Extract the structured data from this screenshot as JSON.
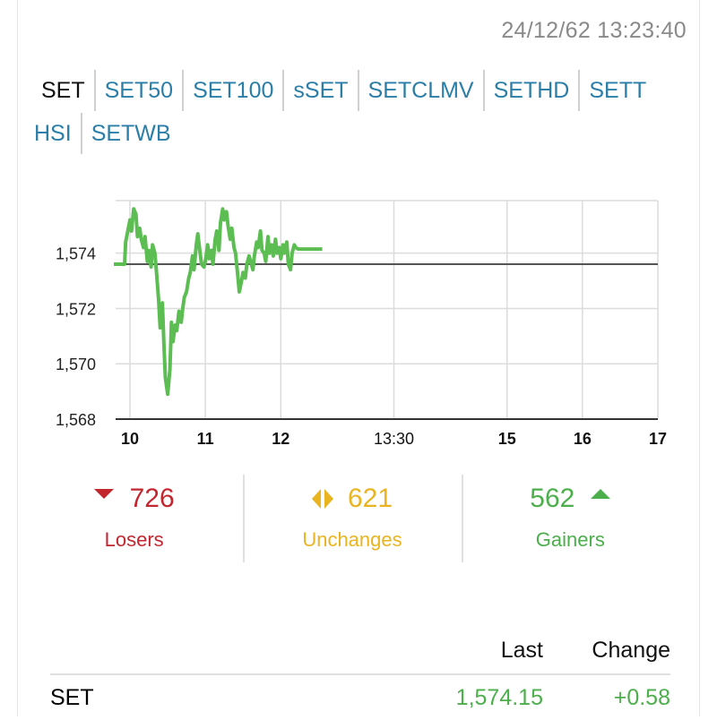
{
  "timestamp": "24/12/62 13:23:40",
  "tabs": {
    "row1": [
      "SET",
      "SET50",
      "SET100",
      "sSET",
      "SETCLMV",
      "SETHD",
      "SETT"
    ],
    "row2": [
      "HSI",
      "SETWB"
    ],
    "active": "SET"
  },
  "chart_data": {
    "type": "line",
    "x_ticks": [
      "10",
      "11",
      "12",
      "13:30",
      "15",
      "16",
      "17"
    ],
    "y_ticks": [
      "1,574",
      "1,572",
      "1,570",
      "1,568"
    ],
    "ylim": [
      1568,
      1575.9
    ],
    "reference_line": 1573.6,
    "series": [
      {
        "color": "#5cbd52",
        "x": [
          9.85,
          9.95,
          9.96,
          9.98,
          10.0,
          10.02,
          10.05,
          10.08,
          10.1,
          10.13,
          10.15,
          10.18,
          10.2,
          10.23,
          10.25,
          10.28,
          10.3,
          10.33,
          10.35,
          10.38,
          10.4,
          10.43,
          10.45,
          10.47,
          10.5,
          10.53,
          10.55,
          10.57,
          10.6,
          10.62,
          10.65,
          10.68,
          10.7,
          10.72,
          10.75,
          10.78,
          10.8,
          10.83,
          10.85,
          10.88,
          10.9,
          10.93,
          10.95,
          10.98,
          11.0,
          11.03,
          11.05,
          11.08,
          11.1,
          11.13,
          11.15,
          11.18,
          11.2,
          11.23,
          11.25,
          11.28,
          11.3,
          11.33,
          11.35,
          11.38,
          11.4,
          11.43,
          11.45,
          11.48,
          11.5,
          11.53,
          11.55,
          11.58,
          11.6,
          11.63,
          11.65,
          11.68,
          11.7,
          11.73,
          11.75,
          11.78,
          11.8,
          11.83,
          11.85,
          11.88,
          11.9,
          11.93,
          11.95,
          11.98,
          12.0,
          12.03,
          12.05,
          12.08,
          12.1,
          12.13,
          12.15,
          12.18,
          12.2,
          12.23,
          12.25,
          12.28,
          12.3,
          12.33,
          12.35,
          12.38,
          12.4,
          12.43,
          12.45,
          12.48,
          12.5,
          12.53,
          12.55
        ],
        "values": [
          1573.6,
          1573.6,
          1574.4,
          1574.8,
          1575.2,
          1574.8,
          1575.6,
          1575.4,
          1574.6,
          1574.9,
          1574.5,
          1574.2,
          1574.6,
          1573.7,
          1574.1,
          1573.5,
          1574.3,
          1574.0,
          1573.4,
          1572.3,
          1571.3,
          1572.2,
          1570.7,
          1569.5,
          1568.9,
          1569.8,
          1571.5,
          1570.8,
          1571.4,
          1571.2,
          1571.9,
          1571.5,
          1572.0,
          1572.4,
          1572.6,
          1573.1,
          1573.3,
          1573.9,
          1573.4,
          1574.3,
          1574.7,
          1574.0,
          1573.6,
          1573.5,
          1573.7,
          1574.3,
          1573.8,
          1574.1,
          1573.6,
          1574.5,
          1574.8,
          1574.1,
          1575.1,
          1575.6,
          1575.2,
          1575.5,
          1575.0,
          1574.5,
          1574.9,
          1574.2,
          1574.0,
          1573.2,
          1572.6,
          1573.0,
          1573.3,
          1573.1,
          1573.6,
          1573.9,
          1573.7,
          1573.4,
          1573.9,
          1574.4,
          1574.2,
          1574.8,
          1574.1,
          1574.0,
          1573.7,
          1574.6,
          1574.0,
          1574.3,
          1573.9,
          1574.5,
          1574.0,
          1574.2,
          1573.8,
          1574.3,
          1574.0,
          1574.4,
          1573.6,
          1573.4,
          1574.0,
          1574.3,
          1574.2,
          1574.15,
          1574.15,
          1574.15,
          1574.15,
          1574.15,
          1574.15,
          1574.15,
          1574.15,
          1574.15,
          1574.15,
          1574.15,
          1574.15,
          1574.15,
          1574.15
        ]
      }
    ]
  },
  "stats": {
    "losers": {
      "count": "726",
      "label": "Losers"
    },
    "unchanged": {
      "count": "621",
      "label": "Unchanges"
    },
    "gainers": {
      "count": "562",
      "label": "Gainers"
    }
  },
  "table": {
    "headers": {
      "name": "",
      "last": "Last",
      "change": "Change"
    },
    "rows": [
      {
        "name": "SET",
        "last": "1,574.15",
        "change": "+0.58"
      }
    ]
  },
  "colors": {
    "link": "#2b7ea8",
    "losers": "#c4262f",
    "unchanged": "#eab320",
    "gainers": "#4caf4c",
    "line": "#5cbd52"
  }
}
